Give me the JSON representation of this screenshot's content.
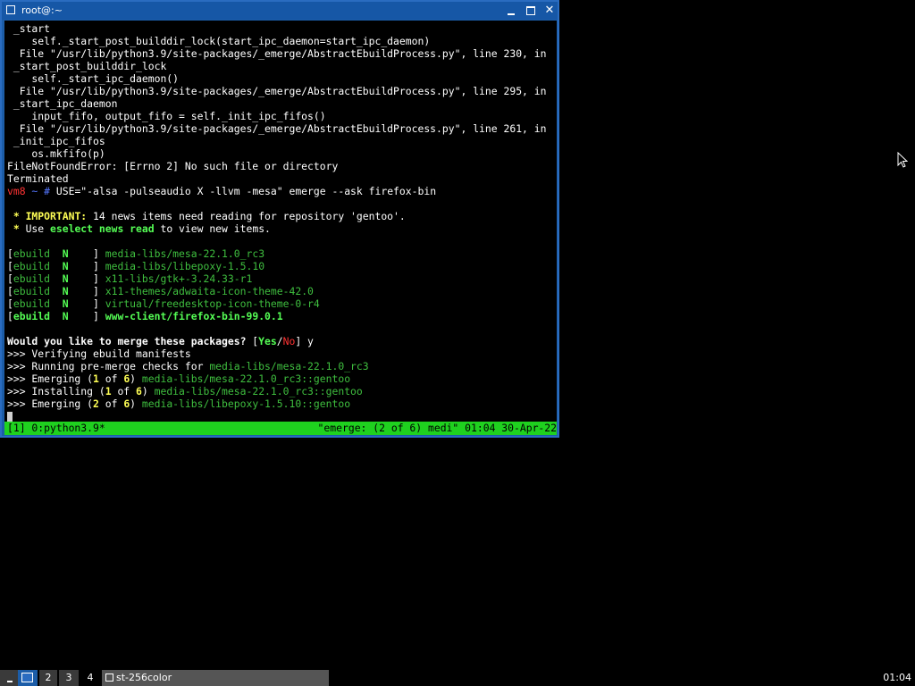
{
  "window": {
    "title": "root@:~",
    "minimize_label": "_",
    "maximize_label": "□",
    "close_label": "✕",
    "colors": {
      "titlebar": "#1657a6",
      "border": "#2a6cc0"
    }
  },
  "terminal": {
    "lines": [
      [
        {
          "t": " _start",
          "c": "white"
        }
      ],
      [
        {
          "t": "    self._start_post_builddir_lock(start_ipc_daemon=start_ipc_daemon)",
          "c": "white"
        }
      ],
      [
        {
          "t": "  File \"/usr/lib/python3.9/site-packages/_emerge/AbstractEbuildProcess.py\", line 230, in",
          "c": "white"
        }
      ],
      [
        {
          "t": " _start_post_builddir_lock",
          "c": "white"
        }
      ],
      [
        {
          "t": "    self._start_ipc_daemon()",
          "c": "white"
        }
      ],
      [
        {
          "t": "  File \"/usr/lib/python3.9/site-packages/_emerge/AbstractEbuildProcess.py\", line 295, in",
          "c": "white"
        }
      ],
      [
        {
          "t": " _start_ipc_daemon",
          "c": "white"
        }
      ],
      [
        {
          "t": "    input_fifo, output_fifo = self._init_ipc_fifos()",
          "c": "white"
        }
      ],
      [
        {
          "t": "  File \"/usr/lib/python3.9/site-packages/_emerge/AbstractEbuildProcess.py\", line 261, in",
          "c": "white"
        }
      ],
      [
        {
          "t": " _init_ipc_fifos",
          "c": "white"
        }
      ],
      [
        {
          "t": "    os.mkfifo(p)",
          "c": "white"
        }
      ],
      [
        {
          "t": "FileNotFoundError: [Errno 2] No such file or directory",
          "c": "white"
        }
      ],
      [
        {
          "t": "Terminated",
          "c": "white"
        }
      ],
      [
        {
          "t": "vm8",
          "c": "red"
        },
        {
          "t": " ~ ",
          "c": "blue"
        },
        {
          "t": "# ",
          "c": "blue"
        },
        {
          "t": "USE=\"-alsa -pulseaudio X -llvm -mesa\" emerge --ask firefox-bin",
          "c": "white"
        }
      ],
      [
        {
          "t": "",
          "c": "white"
        }
      ],
      [
        {
          "t": " * ",
          "c": "yellow"
        },
        {
          "t": "IMPORTANT:",
          "c": "yellow"
        },
        {
          "t": " 14 news items need reading for repository 'gentoo'.",
          "c": "white"
        }
      ],
      [
        {
          "t": " * ",
          "c": "yellow"
        },
        {
          "t": "Use ",
          "c": "white"
        },
        {
          "t": "eselect news read",
          "c": "bgreen"
        },
        {
          "t": " to view new items.",
          "c": "white"
        }
      ],
      [
        {
          "t": "",
          "c": "white"
        }
      ],
      [
        {
          "t": "[",
          "c": "white"
        },
        {
          "t": "ebuild  ",
          "c": "green"
        },
        {
          "t": "N",
          "c": "bgreen"
        },
        {
          "t": "    ] ",
          "c": "white"
        },
        {
          "t": "media-libs/mesa-22.1.0_rc3",
          "c": "green"
        }
      ],
      [
        {
          "t": "[",
          "c": "white"
        },
        {
          "t": "ebuild  ",
          "c": "green"
        },
        {
          "t": "N",
          "c": "bgreen"
        },
        {
          "t": "    ] ",
          "c": "white"
        },
        {
          "t": "media-libs/libepoxy-1.5.10",
          "c": "green"
        }
      ],
      [
        {
          "t": "[",
          "c": "white"
        },
        {
          "t": "ebuild  ",
          "c": "green"
        },
        {
          "t": "N",
          "c": "bgreen"
        },
        {
          "t": "    ] ",
          "c": "white"
        },
        {
          "t": "x11-libs/gtk+-3.24.33-r1",
          "c": "green"
        }
      ],
      [
        {
          "t": "[",
          "c": "white"
        },
        {
          "t": "ebuild  ",
          "c": "green"
        },
        {
          "t": "N",
          "c": "bgreen"
        },
        {
          "t": "    ] ",
          "c": "white"
        },
        {
          "t": "x11-themes/adwaita-icon-theme-42.0",
          "c": "green"
        }
      ],
      [
        {
          "t": "[",
          "c": "white"
        },
        {
          "t": "ebuild  ",
          "c": "green"
        },
        {
          "t": "N",
          "c": "bgreen"
        },
        {
          "t": "    ] ",
          "c": "white"
        },
        {
          "t": "virtual/freedesktop-icon-theme-0-r4",
          "c": "green"
        }
      ],
      [
        {
          "t": "[",
          "c": "white"
        },
        {
          "t": "ebuild  ",
          "c": "bgreen"
        },
        {
          "t": "N",
          "c": "bgreen"
        },
        {
          "t": "    ] ",
          "c": "white"
        },
        {
          "t": "www-client/firefox-bin-99.0.1",
          "c": "bgreen"
        }
      ],
      [
        {
          "t": "",
          "c": "white"
        }
      ],
      [
        {
          "t": "Would you like to merge these packages?",
          "c": "bold"
        },
        {
          "t": " [",
          "c": "white"
        },
        {
          "t": "Yes",
          "c": "bgreen"
        },
        {
          "t": "/",
          "c": "white"
        },
        {
          "t": "No",
          "c": "red"
        },
        {
          "t": "] y",
          "c": "white"
        }
      ],
      [
        {
          "t": ">>> Verifying ebuild manifests",
          "c": "white"
        }
      ],
      [
        {
          "t": ">>> Running pre-merge checks for ",
          "c": "white"
        },
        {
          "t": "media-libs/mesa-22.1.0_rc3",
          "c": "green"
        }
      ],
      [
        {
          "t": ">>> Emerging (",
          "c": "white"
        },
        {
          "t": "1",
          "c": "yellow"
        },
        {
          "t": " of ",
          "c": "white"
        },
        {
          "t": "6",
          "c": "yellow"
        },
        {
          "t": ") ",
          "c": "white"
        },
        {
          "t": "media-libs/mesa-22.1.0_rc3::gentoo",
          "c": "green"
        }
      ],
      [
        {
          "t": ">>> Installing (",
          "c": "white"
        },
        {
          "t": "1",
          "c": "yellow"
        },
        {
          "t": " of ",
          "c": "white"
        },
        {
          "t": "6",
          "c": "yellow"
        },
        {
          "t": ") ",
          "c": "white"
        },
        {
          "t": "media-libs/mesa-22.1.0_rc3::gentoo",
          "c": "green"
        }
      ],
      [
        {
          "t": ">>> Emerging (",
          "c": "white"
        },
        {
          "t": "2",
          "c": "yellow"
        },
        {
          "t": " of ",
          "c": "white"
        },
        {
          "t": "6",
          "c": "yellow"
        },
        {
          "t": ") ",
          "c": "white"
        },
        {
          "t": "media-libs/libepoxy-1.5.10::gentoo",
          "c": "green"
        }
      ]
    ],
    "colors": {
      "background": "#000000",
      "foreground": "#ffffff",
      "green": "#3fbf3f",
      "bright_green": "#55ff55",
      "yellow": "#ffff55",
      "red": "#ff3333"
    }
  },
  "statusbar": {
    "left": "[1] 0:python3.9*",
    "right": "\"emerge: (2 of 6) medi\" 01:04 30-Apr-22",
    "color": "#1fd11f"
  },
  "taskbar": {
    "workspaces": [
      {
        "label": "1",
        "active": true
      },
      {
        "label": "2",
        "active": false
      },
      {
        "label": "3",
        "active": false
      },
      {
        "label": "4",
        "active": false
      }
    ],
    "task_label": "st-256color",
    "clock": "01:04"
  }
}
